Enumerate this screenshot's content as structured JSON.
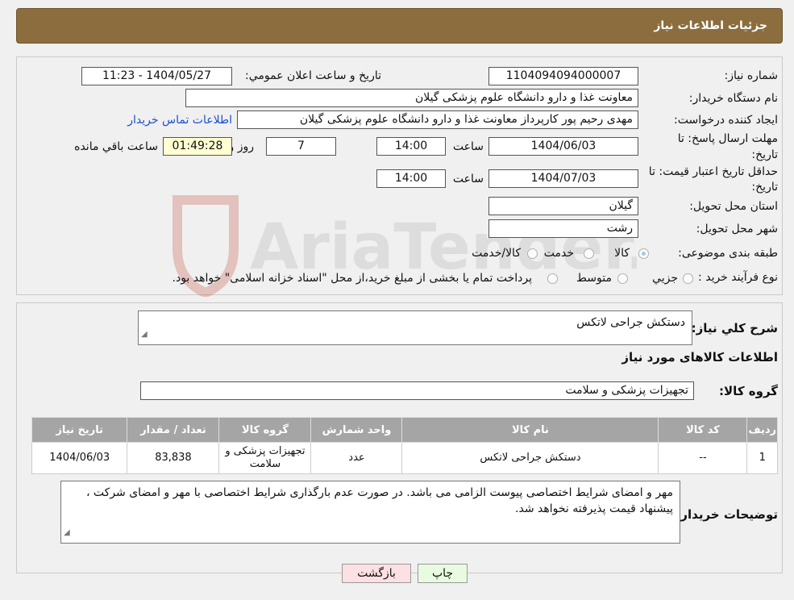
{
  "header": {
    "title": "جزئیات اطلاعات نیاز"
  },
  "form": {
    "need_number_label": "شماره نیاز:",
    "need_number": "1104094094000007",
    "announce_label": "تاریخ و ساعت اعلان عمومي:",
    "announce_value": "1404/05/27 - 11:23",
    "buyer_org_label": "نام دستگاه خريدار:",
    "buyer_org": "معاونت غذا و دارو دانشگاه علوم پزشکی گیلان",
    "creator_label": "ایجاد کننده درخواست:",
    "creator": "مهدی رحیم پور کارپرداز معاونت غذا و دارو دانشگاه علوم پزشکی گیلان",
    "contact_link": "اطلاعات تماس خریدار",
    "deadline_label_1": "مهلت ارسال پاسخ: تا",
    "deadline_label_2": "تاریخ:",
    "deadline_date": "1404/06/03",
    "time_word": "ساعت",
    "deadline_time": "14:00",
    "days": "7",
    "days_and": "روز و",
    "remaining_time": "01:49:28",
    "remaining_word": "ساعت باقي مانده",
    "validity_label_1": "حداقل تاریخ اعتبار قیمت: تا",
    "validity_label_2": "تاریخ:",
    "validity_date": "1404/07/03",
    "validity_time": "14:00",
    "province_label": "استان محل تحویل:",
    "province": "گیلان",
    "city_label": "شهر محل تحویل:",
    "city": "رشت",
    "category_label": "طبقه بندی موضوعی:",
    "category_options": [
      "کالا",
      "خدمت",
      "کالا/خدمت"
    ],
    "process_label": "نوع فرآیند خرید :",
    "process_options": [
      "جزیي",
      "متوسط"
    ],
    "process_note": "پرداخت تمام یا بخشی از مبلغ خرید،از محل \"اسناد خزانه اسلامی\" خواهد بود."
  },
  "description": {
    "label": "شرح كلي نياز:",
    "value": "دستکش جراحی لاتکس",
    "items_heading": "اطلاعات کالاهای مورد نیاز",
    "group_label": "گروه کالا:",
    "group_value": "تجهیزات پزشکی و سلامت"
  },
  "table": {
    "headers": [
      "ردیف",
      "کد کالا",
      "نام کالا",
      "واحد شمارش",
      "گروه کالا",
      "تعداد / مقدار",
      "تاریخ نیاز"
    ],
    "rows": [
      [
        "1",
        "--",
        "دستکش جراحی لاتکس",
        "عدد",
        "تجهیزات پزشکی و سلامت",
        "83,838",
        "1404/06/03"
      ]
    ]
  },
  "buyer_notes": {
    "label": "توضیحات خریدار:",
    "value": "مهر و امضای شرایط اختصاصی پیوست الزامی می باشد. در صورت عدم بارگذاری شرایط اختصاصی با مهر و امضای شرکت ، پیشنهاد قیمت پذیرفته نخواهد شد."
  },
  "buttons": {
    "print": "چاپ",
    "back": "بازگشت"
  },
  "watermark": {
    "text": "AriaTender.neT"
  },
  "colors": {
    "header": "#8c6d3e",
    "link": "#1a4fd6",
    "timer": "#ffffd2"
  }
}
